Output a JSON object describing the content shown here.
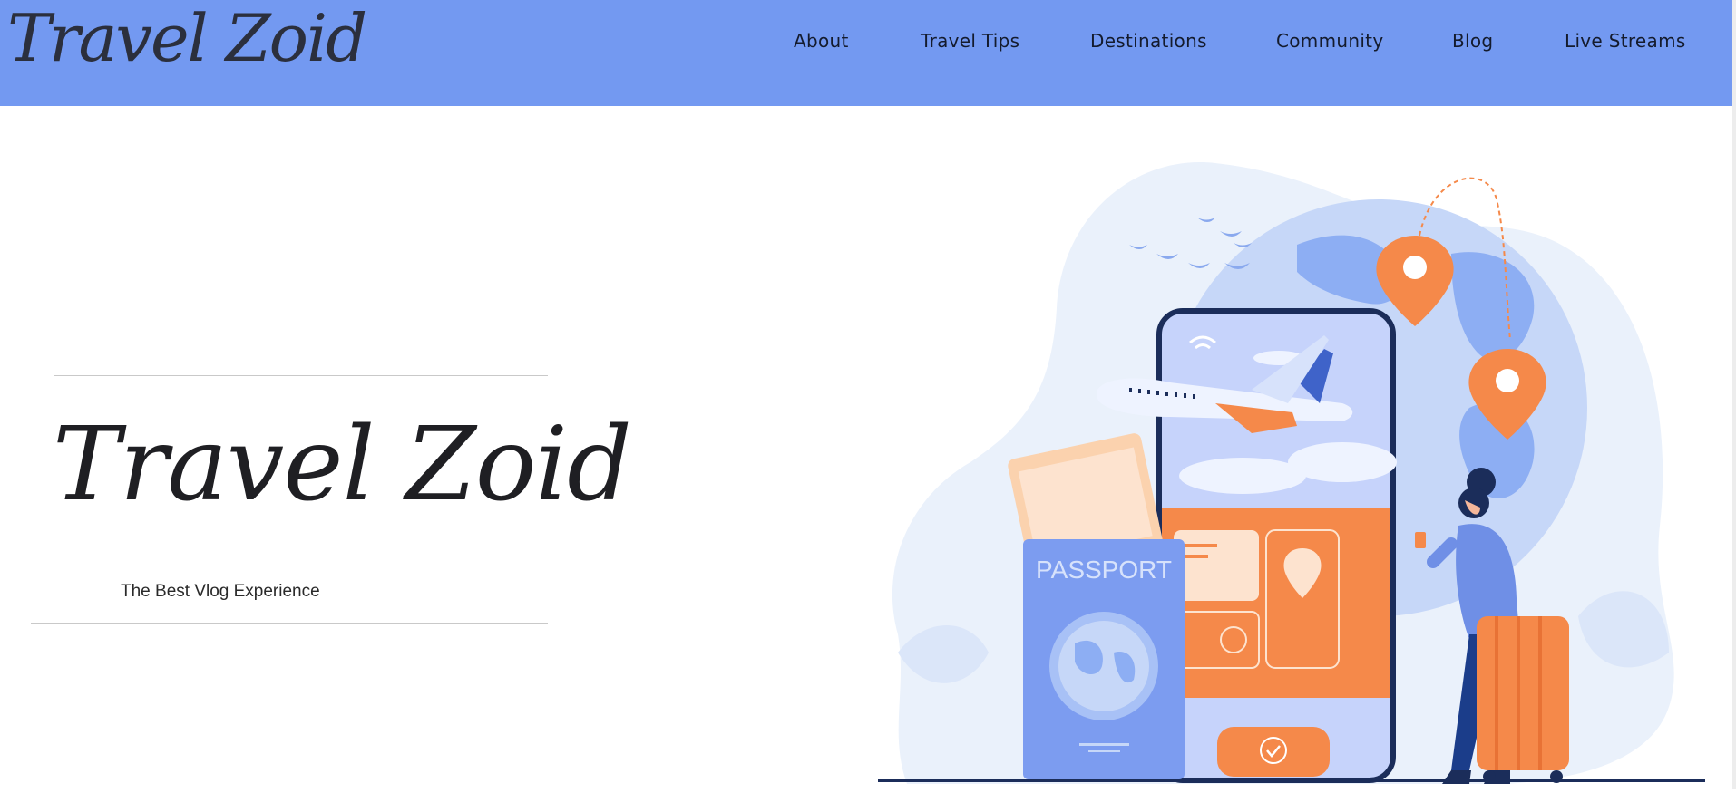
{
  "navbar": {
    "brand": "Travel Zoid",
    "links": [
      "About",
      "Travel Tips",
      "Destinations",
      "Community",
      "Blog",
      "Live Streams"
    ]
  },
  "hero": {
    "title": "Travel Zoid",
    "subtitle": "The Best Vlog Experience"
  },
  "illustration": {
    "passport_label": "PASSPORT"
  },
  "colors": {
    "navbar_bg": "#7399f1",
    "accent_orange": "#f5894a",
    "accent_blue": "#7c9cf0",
    "dark_navy": "#1b2d5a"
  }
}
